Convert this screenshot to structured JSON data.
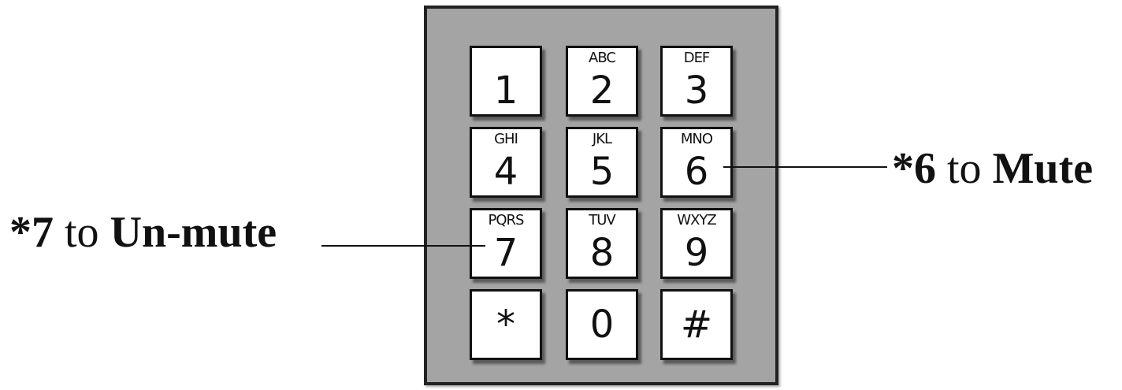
{
  "keypad": {
    "keys": [
      {
        "digit": "1",
        "letters": ""
      },
      {
        "digit": "2",
        "letters": "ABC"
      },
      {
        "digit": "3",
        "letters": "DEF"
      },
      {
        "digit": "4",
        "letters": "GHI"
      },
      {
        "digit": "5",
        "letters": "JKL"
      },
      {
        "digit": "6",
        "letters": "MNO"
      },
      {
        "digit": "7",
        "letters": "PQRS"
      },
      {
        "digit": "8",
        "letters": "TUV"
      },
      {
        "digit": "9",
        "letters": "WXYZ"
      },
      {
        "digit": "*",
        "letters": ""
      },
      {
        "digit": "0",
        "letters": ""
      },
      {
        "digit": "#",
        "letters": ""
      }
    ]
  },
  "callouts": {
    "mute": {
      "code": "*6",
      "connector": "to",
      "action": "Mute"
    },
    "unmute": {
      "code": "*7",
      "connector": "to",
      "action": "Un-mute"
    }
  }
}
